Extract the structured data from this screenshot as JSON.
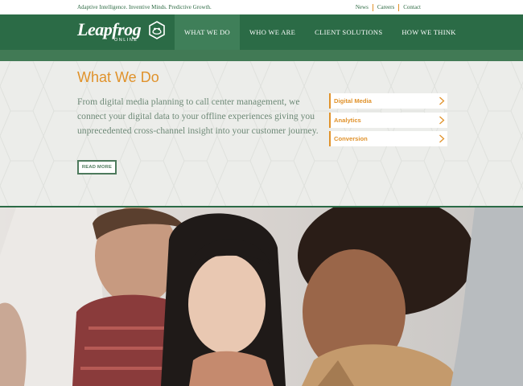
{
  "topbar": {
    "tagline": "Adaptive Intelligence. Inventive Minds. Predictive Growth.",
    "links": [
      "News",
      "Careers",
      "Contact"
    ]
  },
  "logo": {
    "word": "Leapfrog",
    "sub": "ONLINE",
    "icon": "frog-hex-icon"
  },
  "nav": {
    "items": [
      "WHAT WE DO",
      "WHO WE ARE",
      "CLIENT SOLUTIONS",
      "HOW WE THINK"
    ],
    "active": "WHAT WE DO"
  },
  "hero": {
    "title": "What We Do",
    "intro": "From digital media planning to call center management, we connect your digital data to your offline experiences giving you unprecedented cross-channel insight into your customer journey.",
    "read_more": "READ MORE",
    "side_links": [
      "Digital Media",
      "Analytics",
      "Conversion"
    ]
  },
  "colors": {
    "brand_green": "#2b6b46",
    "accent_orange": "#e0922b",
    "text_green": "#6f8a78",
    "hero_bg": "#ecedea"
  },
  "photo": {
    "description_icon": "team-photo"
  }
}
